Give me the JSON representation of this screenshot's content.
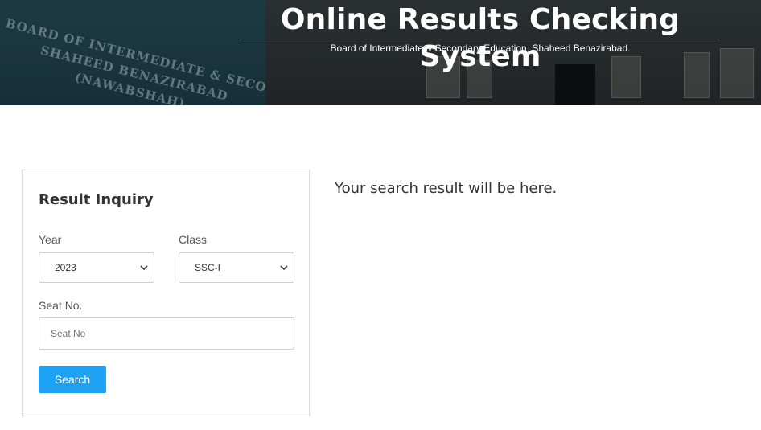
{
  "header": {
    "title": "Online Results Checking System",
    "subtitle": "Board of Intermediate & Secondary Education, Shaheed Benazirabad.",
    "sign_lines": [
      "BOARD OF INTERMEDIATE & SECONDARY EDUCATION",
      "SHAHEED BENAZIRABAD",
      "(NAWABSHAH)"
    ]
  },
  "form": {
    "title": "Result Inquiry",
    "year_label": "Year",
    "year_value": "2023",
    "class_label": "Class",
    "class_value": "SSC-I",
    "seat_label": "Seat No.",
    "seat_placeholder": "Seat No",
    "search_label": "Search"
  },
  "result": {
    "message": "Your search result will be here."
  },
  "colors": {
    "accent": "#1da1f2",
    "header_text": "#ffffff"
  }
}
